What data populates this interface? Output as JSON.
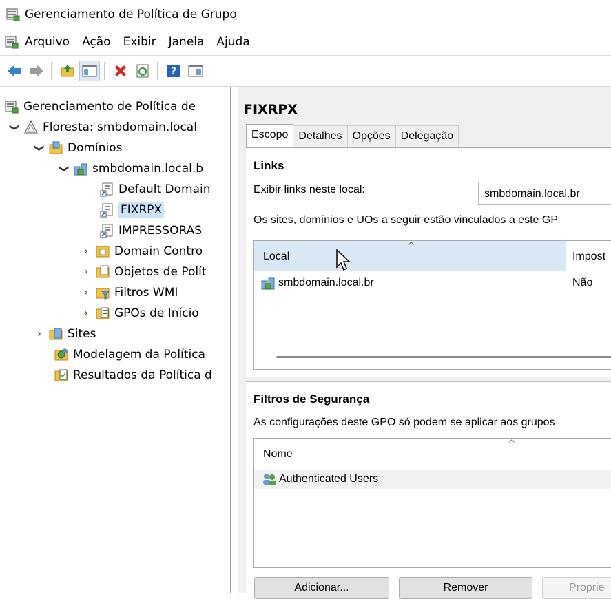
{
  "window": {
    "title": "Gerenciamento de Política de Grupo"
  },
  "menu": [
    "Arquivo",
    "Ação",
    "Exibir",
    "Janela",
    "Ajuda"
  ],
  "toolbar": {
    "buttons": [
      "back-arrow-icon",
      "forward-arrow-icon",
      "up-folder-icon",
      "show-hide-tree-icon",
      "delete-icon",
      "refresh-icon",
      "help-icon",
      "properties-icon"
    ]
  },
  "tree": {
    "root": "Gerenciamento de Política de",
    "forest": "Floresta: smbdomain.local",
    "domains": "Domínios",
    "domain": "smbdomain.local.b",
    "gpo_default": "Default Domain",
    "gpo_fixrpx": "FIXRPX",
    "gpo_impressoras": "IMPRESSORAS",
    "domain_controllers": "Domain Contro",
    "gpo_objects": "Objetos de Polít",
    "wmi_filters": "Filtros WMI",
    "starter_gpos": "GPOs de Início",
    "sites": "Sites",
    "modeling": "Modelagem da Política",
    "results": "Resultados da Política d"
  },
  "detail": {
    "title": "FIXRPX",
    "tabs": [
      "Escopo",
      "Detalhes",
      "Opções",
      "Delegação"
    ],
    "links": {
      "heading": "Links",
      "show_label": "Exibir links neste local:",
      "show_value": "smbdomain.local.br",
      "info": "Os sites, domínios e UOs a seguir estão vinculados a este GP",
      "col_local": "Local",
      "col_enforced": "Impost",
      "rows": [
        {
          "local": "smbdomain.local.br",
          "enforced": "Não"
        }
      ]
    },
    "security": {
      "heading": "Filtros de Segurança",
      "info": "As configurações deste GPO só podem se aplicar aos grupos",
      "col_name": "Nome",
      "rows": [
        {
          "name": "Authenticated Users"
        }
      ],
      "btn_add": "Adicionar...",
      "btn_remove": "Remover",
      "btn_props": "Proprie"
    }
  },
  "colors": {
    "selection": "#cce4f7",
    "header_highlight": "#dbe9f7",
    "pane_bg": "#f0f0f0"
  }
}
